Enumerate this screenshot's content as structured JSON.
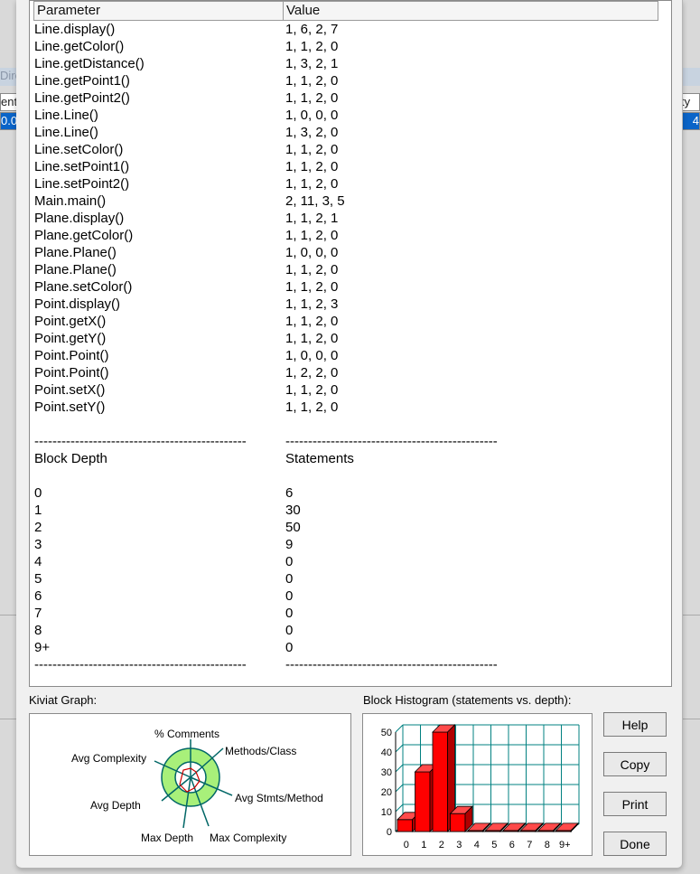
{
  "background": {
    "strip_label": "Dire",
    "left_cells": [
      "ent",
      "0.0"
    ],
    "right_cells": [
      "ty",
      "4"
    ]
  },
  "table": {
    "columns": [
      "Parameter",
      "Value"
    ],
    "rows": [
      [
        "Line.display()",
        "1, 6, 2, 7"
      ],
      [
        "Line.getColor()",
        "1, 1, 2, 0"
      ],
      [
        "Line.getDistance()",
        "1, 3, 2, 1"
      ],
      [
        "Line.getPoint1()",
        "1, 1, 2, 0"
      ],
      [
        "Line.getPoint2()",
        "1, 1, 2, 0"
      ],
      [
        "Line.Line()",
        "1, 0, 0, 0"
      ],
      [
        "Line.Line()",
        "1, 3, 2, 0"
      ],
      [
        "Line.setColor()",
        "1, 1, 2, 0"
      ],
      [
        "Line.setPoint1()",
        "1, 1, 2, 0"
      ],
      [
        "Line.setPoint2()",
        "1, 1, 2, 0"
      ],
      [
        "Main.main()",
        "2, 11, 3, 5"
      ],
      [
        "Plane.display()",
        "1, 1, 2, 1"
      ],
      [
        "Plane.getColor()",
        "1, 1, 2, 0"
      ],
      [
        "Plane.Plane()",
        "1, 0, 0, 0"
      ],
      [
        "Plane.Plane()",
        "1, 1, 2, 0"
      ],
      [
        "Plane.setColor()",
        "1, 1, 2, 0"
      ],
      [
        "Point.display()",
        "1, 1, 2, 3"
      ],
      [
        "Point.getX()",
        "1, 1, 2, 0"
      ],
      [
        "Point.getY()",
        "1, 1, 2, 0"
      ],
      [
        "Point.Point()",
        "1, 0, 0, 0"
      ],
      [
        "Point.Point()",
        "1, 2, 2, 0"
      ],
      [
        "Point.setX()",
        "1, 1, 2, 0"
      ],
      [
        "Point.setY()",
        "1, 1, 2, 0"
      ],
      [
        "",
        ""
      ],
      [
        "-----------------------------------------------",
        "-----------------------------------------------"
      ],
      [
        "Block Depth",
        "Statements"
      ],
      [
        "",
        ""
      ],
      [
        "0",
        "6"
      ],
      [
        "1",
        "30"
      ],
      [
        "2",
        "50"
      ],
      [
        "3",
        "9"
      ],
      [
        "4",
        "0"
      ],
      [
        "5",
        "0"
      ],
      [
        "6",
        "0"
      ],
      [
        "7",
        "0"
      ],
      [
        "8",
        "0"
      ],
      [
        "9+",
        "0"
      ],
      [
        "-----------------------------------------------",
        "-----------------------------------------------"
      ]
    ]
  },
  "kiviat": {
    "label": "Kiviat Graph:",
    "axes": [
      "% Comments",
      "Methods/Class",
      "Avg Stmts/Method",
      "Max Complexity",
      "Max Depth",
      "Avg Depth",
      "Avg Complexity"
    ]
  },
  "histogram": {
    "label": "Block Histogram (statements vs. depth):"
  },
  "chart_data": {
    "type": "bar",
    "title": "Block Histogram (statements vs. depth):",
    "categories": [
      "0",
      "1",
      "2",
      "3",
      "4",
      "5",
      "6",
      "7",
      "8",
      "9+"
    ],
    "values": [
      6,
      30,
      50,
      9,
      0,
      0,
      0,
      0,
      0,
      0
    ],
    "yticks": [
      "0",
      "10",
      "20",
      "30",
      "40",
      "50"
    ],
    "ylim": [
      0,
      50
    ],
    "bar_color": "#ff0000",
    "grid_color": "#008080"
  },
  "buttons": {
    "help": "Help",
    "copy": "Copy",
    "print": "Print",
    "done": "Done"
  },
  "colors": {
    "kiviat_fill": "#a8f07a",
    "selection": "#0a64c8"
  }
}
